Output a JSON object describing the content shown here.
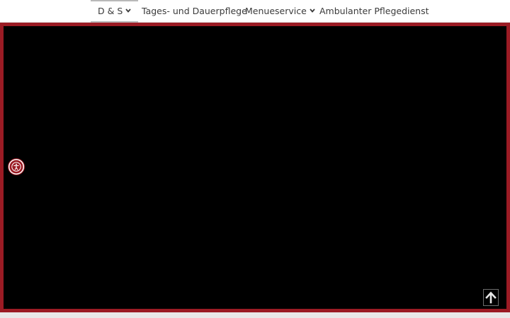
{
  "nav": {
    "items": [
      {
        "label": "D & S",
        "has_dropdown": true,
        "active": true
      },
      {
        "label": "Tages- und Dauerpflege",
        "has_dropdown": false,
        "active": false
      },
      {
        "label": "Menueservice",
        "has_dropdown": true,
        "active": false
      },
      {
        "label": "Ambulanter Pflegedienst",
        "has_dropdown": false,
        "active": false
      }
    ]
  },
  "icons": {
    "dropdown": "chevron-down-icon",
    "accessibility": "accessibility-icon",
    "scroll_top": "arrow-up-icon"
  },
  "colors": {
    "accent": "#9b1b24",
    "hero_background": "#000000",
    "nav_text": "#3b3b3b"
  }
}
